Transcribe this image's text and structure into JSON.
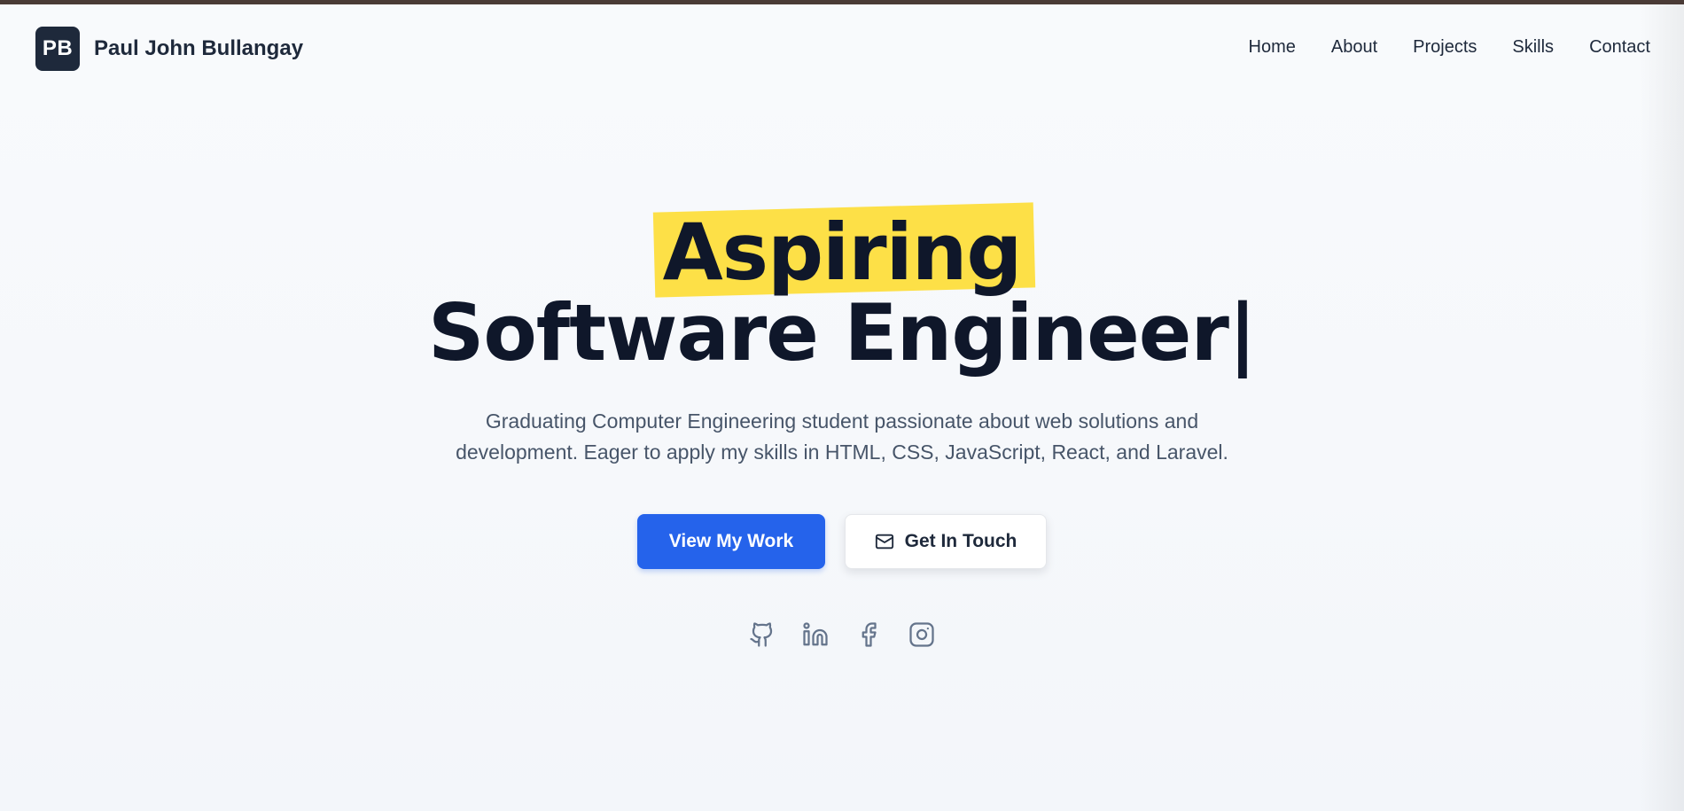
{
  "header": {
    "logo_initials": "PB",
    "name": "Paul John Bullangay",
    "nav": [
      {
        "label": "Home"
      },
      {
        "label": "About"
      },
      {
        "label": "Projects"
      },
      {
        "label": "Skills"
      },
      {
        "label": "Contact"
      }
    ]
  },
  "hero": {
    "title_line1": "Aspiring",
    "title_line2": "Software Engineer",
    "caret": "|",
    "description_line1": "Graduating Computer Engineering student passionate about web solutions and",
    "description_line2": "development. Eager to apply my skills in HTML, CSS, JavaScript, React, and Laravel.",
    "primary_button": "View My Work",
    "secondary_button": "Get In Touch"
  },
  "socials": [
    {
      "icon": "github-icon"
    },
    {
      "icon": "linkedin-icon"
    },
    {
      "icon": "facebook-icon"
    },
    {
      "icon": "instagram-icon"
    }
  ],
  "colors": {
    "accent": "#2563eb",
    "highlight": "#fde047",
    "heading": "#0f172a",
    "logo_bg": "#1e293b",
    "body_text": "#475569",
    "icon": "#64748b"
  }
}
